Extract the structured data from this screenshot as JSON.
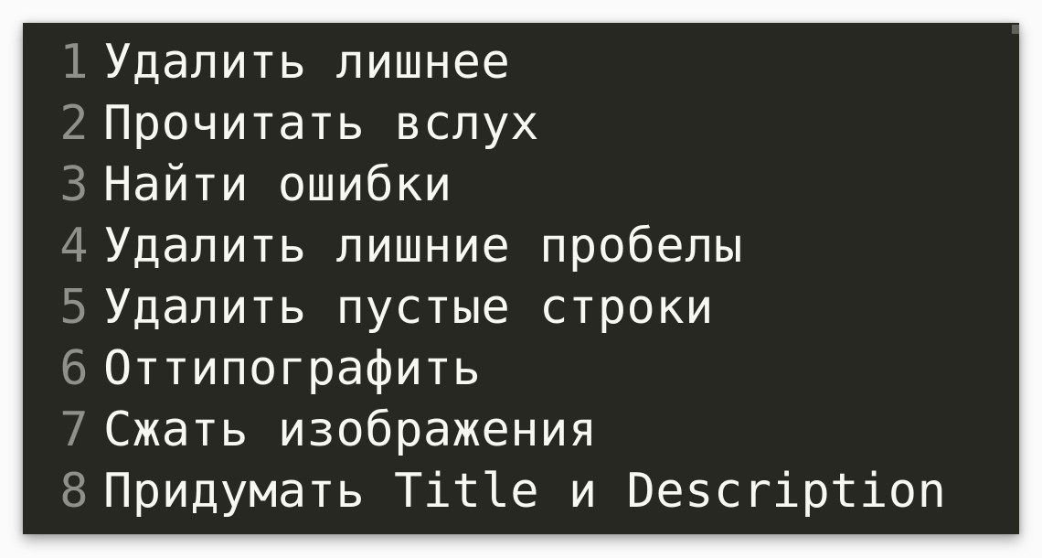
{
  "editor": {
    "theme_colors": {
      "background": "#272822",
      "gutter_text": "#8f908a",
      "text": "#f8f8f2"
    },
    "lines": [
      {
        "number": "1",
        "text": "Удалить лишнее"
      },
      {
        "number": "2",
        "text": "Прочитать вслух"
      },
      {
        "number": "3",
        "text": "Найти ошибки"
      },
      {
        "number": "4",
        "text": "Удалить лишние пробелы"
      },
      {
        "number": "5",
        "text": "Удалить пустые строки"
      },
      {
        "number": "6",
        "text": "Оттипографить"
      },
      {
        "number": "7",
        "text": "Сжать изображения"
      },
      {
        "number": "8",
        "text": "Придумать Title и Description"
      }
    ]
  }
}
